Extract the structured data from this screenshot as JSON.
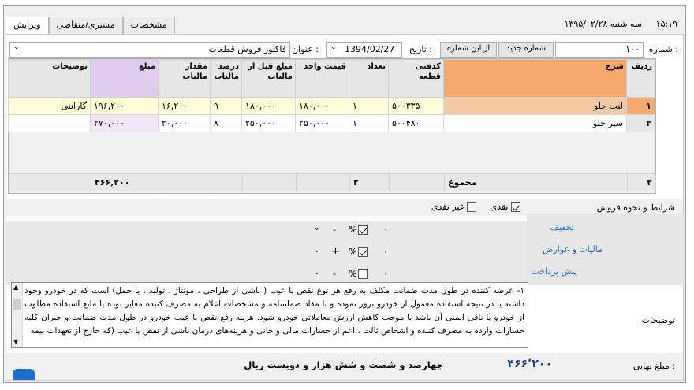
{
  "tabs": [
    {
      "label": "ویرایش",
      "active": true
    },
    {
      "label": "مشتری/متقاضی",
      "active": false
    },
    {
      "label": "مشخصات",
      "active": false
    }
  ],
  "clock": {
    "time": "۱۵:۱۹",
    "date": "سه شنبه ۱۳۹۵/۰۲/۲۸"
  },
  "header": {
    "number_label": "شماره :",
    "number_value": "۱۰۰",
    "new_number_button": "شماره جدید",
    "from_number_button": "از این شماره",
    "date_label": "تاریخ :",
    "date_value": "1394/02/27",
    "title_label": "عنوان :",
    "title_value": "فاکتور فروش قطعات"
  },
  "grid": {
    "columns": [
      "ردیف",
      "شرح",
      "کدفنی قطعه",
      "تعداد",
      "قیمت واحد",
      "مبلغ قبل از مالیات",
      "درصد مالیات",
      "مقدار مالیات",
      "مبلغ",
      "توضیحات"
    ],
    "rows": [
      {
        "radif": "۱",
        "sharh": "لنت جلو",
        "code": "۵۰۰۳۳۵",
        "count": "۱",
        "unit_price": "۱۸۰,۰۰۰",
        "before_tax": "۱۸۰,۰۰۰",
        "tax_pct": "۹",
        "tax_amount": "۱۶,۲۰۰",
        "amount": "۱۹۶,۲۰۰",
        "desc": "گارانتی"
      },
      {
        "radif": "۲",
        "sharh": "سپر جلو",
        "code": "۵۰۰۴۸۰",
        "count": "۱",
        "unit_price": "۲۵۰,۰۰۰",
        "before_tax": "۲۵۰,۰۰۰",
        "tax_pct": "۸",
        "tax_amount": "۲۰,۰۰۰",
        "amount": "۲۷۰,۰۰۰",
        "desc": ""
      }
    ],
    "totals": {
      "radif": "۲",
      "label": "مجموع",
      "count": "۲",
      "amount": "۴۶۶,۲۰۰"
    }
  },
  "payment": {
    "label": "شرایط و نحوه فروش",
    "cash": "نقدی",
    "cash_checked": true,
    "noncash": "غیر نقدی",
    "noncash_checked": false
  },
  "adjustments": [
    {
      "label": "تخفیف",
      "value": "۰",
      "pct_checked": true,
      "sign": "-"
    },
    {
      "label": "مالیات و عوارض",
      "value": "۰",
      "pct_checked": true,
      "sign": "+"
    },
    {
      "label": "پیش پرداخت",
      "value": "۰",
      "pct_checked": false,
      "sign": "-"
    }
  ],
  "notes": {
    "label": "توضیحات",
    "text": "۱- عرضه کننده در طول مدت ضمانت مکلف به رفع هر نوع نقص یا عیب ( ناشی از طراحی ، مونتاژ ، تولید ، یا حمل) است که در خودرو وجود داشته یا در نتیجه استفاده معمول از خودرو بروز نموده و یا مفاد ضمانتنامه و مشخصات اعلام به مصرف کننده مغایر بوده یا مانع استفاده مطلوب از خودرو یا ناقی ایمنی آن باشد یا موجب کاهش ارزش معاملاتی خودرو شود. هزینه رفع نقص یا عیب خودرو در طول مدت ضمانت و جبران کلیه خسارات وارده به مصرف کننده و اشخاص ثالث ، اعم از خسارات مالی و جانی و هزینه‌های درمان ناشی از نقص یا عیب (که خارج از تعهدات بیمه"
  },
  "final": {
    "label": "مبلغ نهایی :",
    "amount": "۴۶۶٬۲۰۰",
    "words": "چهارصد و شصت و شش هزار و دویست ریال"
  }
}
